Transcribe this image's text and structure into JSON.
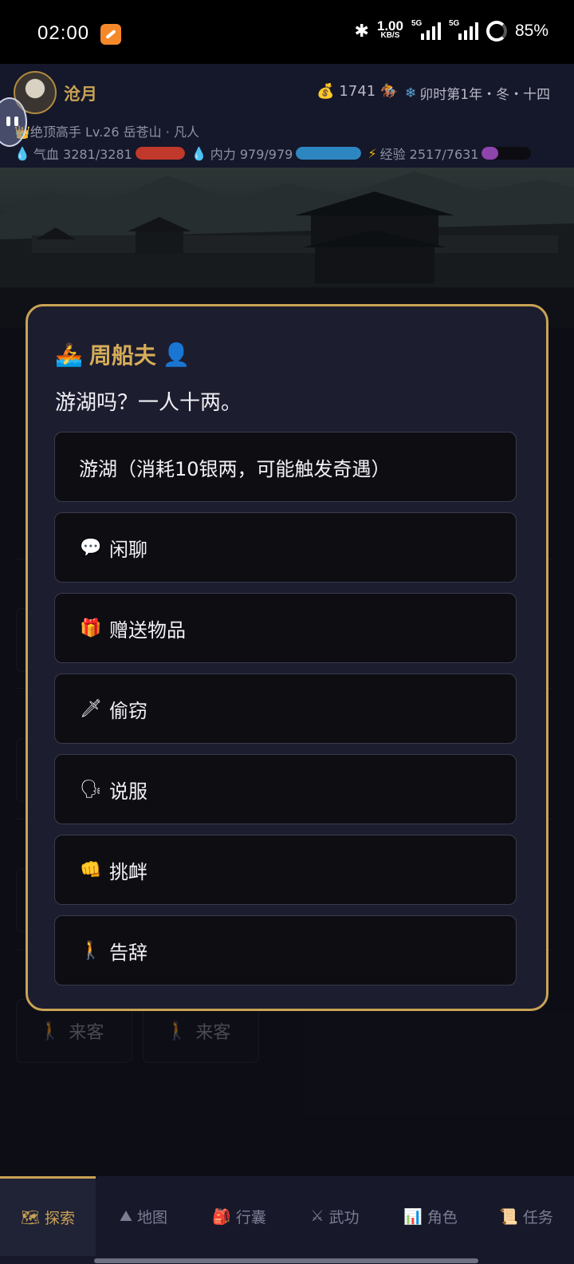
{
  "status_bar": {
    "time": "02:00",
    "net_speed": "1.00",
    "net_unit": "KB/S",
    "signal_1": "5G",
    "signal_2": "5G",
    "battery": "85%"
  },
  "player": {
    "name": "沧月",
    "rank_line": "绝顶高手 Lv.26 岳苍山 · 凡人",
    "money": "1741",
    "season": "卯时第1年・冬・十四",
    "hp_label": "气血 3281/3281",
    "hp_fraction": 1.0,
    "mp_label": "内力 979/979",
    "mp_fraction": 1.0,
    "exp_label": "经验 2517/7631",
    "exp_fraction": 0.33,
    "colors": {
      "hp": "#c0392b",
      "mp": "#2e86c1",
      "exp": "#8e44ad"
    }
  },
  "dialog": {
    "npc_name": "周船夫",
    "npc_line": "游湖吗？一人十两。",
    "options": [
      {
        "icon": "",
        "label": "游湖（消耗10银两，可能触发奇遇）"
      },
      {
        "icon": "💬",
        "label": "闲聊"
      },
      {
        "icon": "🎁",
        "label": "赠送物品"
      },
      {
        "icon": "🗡",
        "label": "偷窃"
      },
      {
        "icon": "🗣",
        "label": "说服"
      },
      {
        "icon": "👊",
        "label": "挑衅"
      },
      {
        "icon": "🚶",
        "label": "告辞"
      }
    ]
  },
  "background": {
    "visitors": [
      "来客",
      "来客"
    ]
  },
  "nav": {
    "tabs": [
      {
        "icon": "🗺",
        "label": "探索"
      },
      {
        "icon": "⛰",
        "label": "地图"
      },
      {
        "icon": "🎒",
        "label": "行囊"
      },
      {
        "icon": "⚔",
        "label": "武功"
      },
      {
        "icon": "📊",
        "label": "角色"
      },
      {
        "icon": "📜",
        "label": "任务"
      }
    ],
    "active": "探索"
  }
}
